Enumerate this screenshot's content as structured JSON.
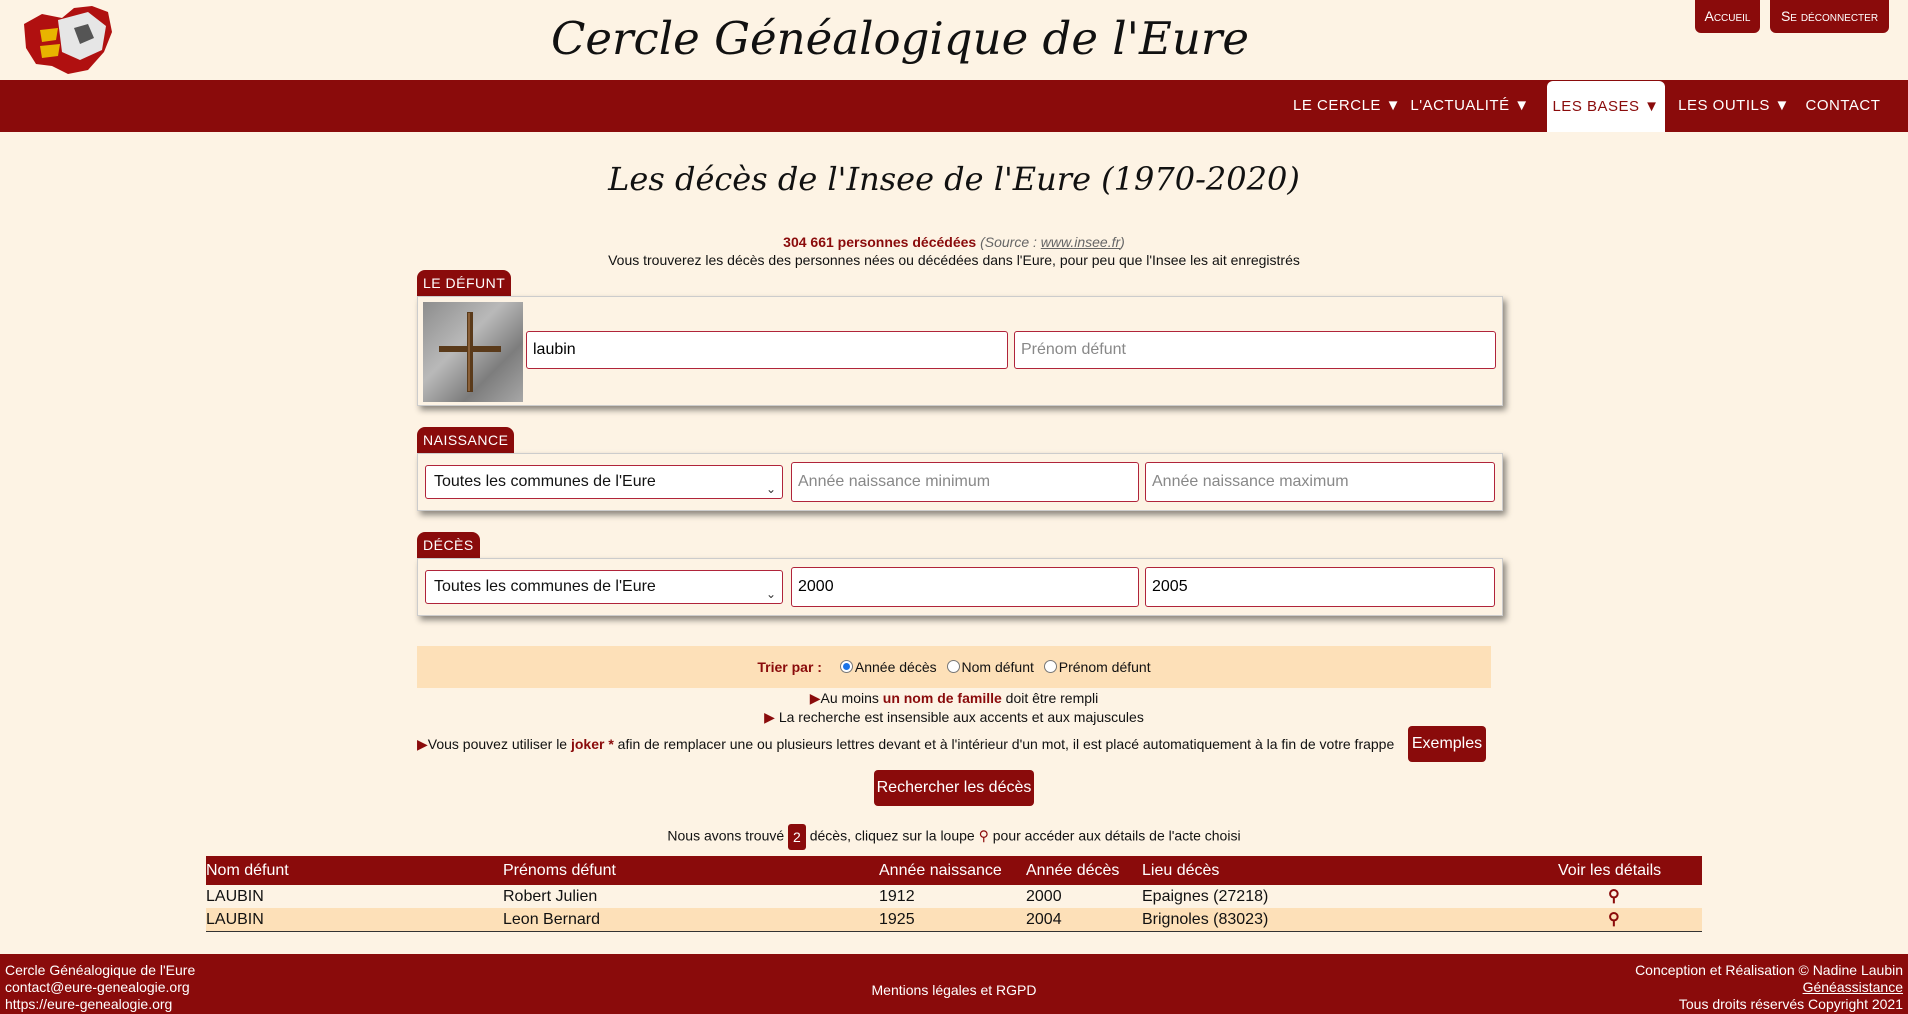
{
  "header": {
    "site_title": "Cercle Généalogique de l'Eure",
    "accueil_label": "Accueil",
    "logout_label": "Se déconnecter"
  },
  "nav": {
    "items": [
      {
        "label": "LE CERCLE ▼"
      },
      {
        "label": "L'ACTUALITÉ ▼"
      },
      {
        "label": "LES BASES ▼"
      },
      {
        "label": "LES OUTILS ▼"
      },
      {
        "label": "CONTACT"
      }
    ],
    "active_index": 2
  },
  "main": {
    "title": "Les décès de l'Insee de l'Eure (1970-2020)",
    "count_text": "304 661 personnes décédées",
    "source_prefix": "(Source : ",
    "source_link": "www.insee.fr",
    "source_suffix": ")",
    "intro": "Vous trouverez les décès des personnes nées ou décédées dans l'Eure, pour peu que l'Insee les ait enregistrés"
  },
  "sections": {
    "defunt": {
      "tab": "LE DÉFUNT",
      "nom_value": "laubin",
      "prenom_placeholder": "Prénom défunt"
    },
    "naissance": {
      "tab": "NAISSANCE",
      "commune": "Toutes les communes de l'Eure",
      "min_placeholder": "Année naissance minimum",
      "max_placeholder": "Année naissance maximum"
    },
    "deces": {
      "tab": "DÉCÈS",
      "commune": "Toutes les communes de l'Eure",
      "min_value": "2000",
      "max_value": "2005"
    }
  },
  "sort": {
    "label": "Trier par :",
    "options": [
      "Année décès",
      "Nom défunt",
      "Prénom défunt"
    ],
    "selected": 0
  },
  "rules": {
    "r1_pre": "Au moins ",
    "r1_bold": "un nom de famille",
    "r1_post": " doit être rempli",
    "r2": " La recherche est insensible aux accents et aux majuscules",
    "r3_pre": "Vous pouvez utiliser le ",
    "r3_bold": "joker *",
    "r3_post": " afin de remplacer une ou plusieurs lettres devant et à l'intérieur d'un mot, il est placé automatiquement à la fin de votre frappe",
    "examples_label": "Exemples",
    "search_label": "Rechercher les décès"
  },
  "found": {
    "pre": "Nous avons trouvé ",
    "count": "2",
    "post": " décès, cliquez sur la loupe ",
    "post2": " pour accéder aux détails de l'acte choisi"
  },
  "results": {
    "headers": [
      "Nom défunt",
      "Prénoms défunt",
      "Année naissance",
      "Année décès",
      "Lieu décès",
      "Voir les détails"
    ],
    "rows": [
      {
        "nom": "LAUBIN",
        "prenoms": "Robert Julien",
        "naissance": "1912",
        "deces": "2000",
        "lieu": "Epaignes (27218)"
      },
      {
        "nom": "LAUBIN",
        "prenoms": "Leon Bernard",
        "naissance": "1925",
        "deces": "2004",
        "lieu": "Brignoles (83023)"
      }
    ]
  },
  "footer": {
    "left1": "Cercle Généalogique de l'Eure",
    "left2": "contact@eure-genealogie.org",
    "left3": "https://eure-genealogie.org",
    "center": "Mentions légales et RGPD",
    "right1": "Conception et Réalisation © Nadine Laubin",
    "right2": "Généassistance",
    "right3": "Tous droits réservés Copyright 2021"
  },
  "colors": {
    "brand": "#8a0b0b",
    "background": "#fdf3e4",
    "highlight": "#fde0b8"
  },
  "icons": [
    "logo-normandy-icon",
    "cross-icon",
    "loupe-icon",
    "chevron-down-icon",
    "triangle-right-icon"
  ]
}
